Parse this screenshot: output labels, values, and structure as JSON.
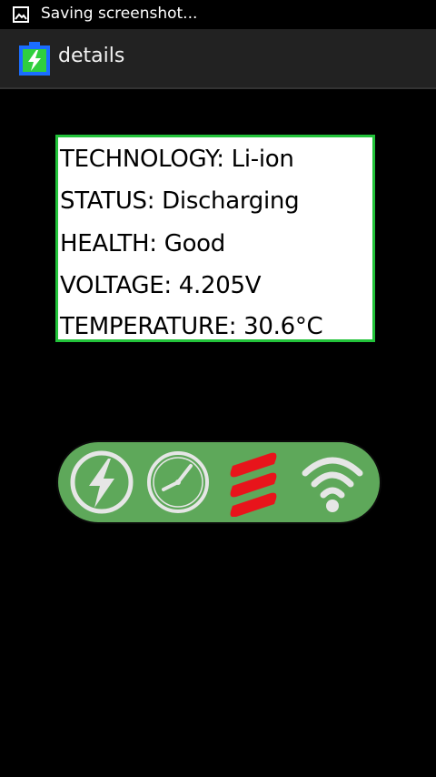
{
  "status_bar": {
    "notification_text": "Saving screenshot..."
  },
  "action_bar": {
    "title": "details",
    "app_icon": "battery-bolt-icon"
  },
  "battery_info": {
    "technology": "TECHNOLOGY: Li-ion",
    "status": "STATUS: Discharging",
    "health": "HEALTH: Good",
    "voltage": "VOLTAGE: 4.205V",
    "temperature": "TEMPERATURE: 30.6°C"
  },
  "toolbar": {
    "buttons": [
      {
        "icon": "lightning-icon"
      },
      {
        "icon": "clock-icon"
      },
      {
        "icon": "red-bars-icon"
      },
      {
        "icon": "wifi-icon"
      }
    ]
  },
  "colors": {
    "card_border": "#22c33a",
    "toolbar_bg": "#5ea85a",
    "accent_red": "#e8141b"
  }
}
